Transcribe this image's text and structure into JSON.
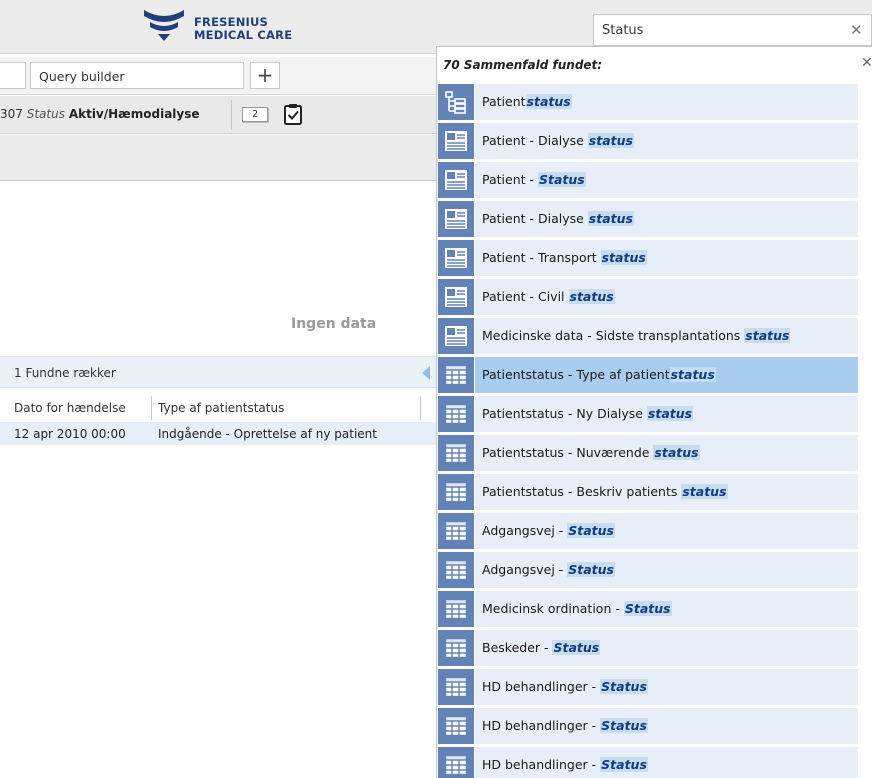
{
  "header": {
    "logo_line1": "FRESENIUS",
    "logo_line2": "MEDICAL CARE",
    "search_value": "Status",
    "search_clear": "✕"
  },
  "tabs": {
    "query_builder": "Query builder",
    "add": "+"
  },
  "status_bar": {
    "number": "307",
    "label": "Status",
    "value": "Aktiv/Hæmodialyse",
    "count": "2"
  },
  "main": {
    "no_data": "Ingen data",
    "found_rows": "1 Fundne rækker",
    "columns": [
      "Dato for hændelse",
      "Type af patientstatus"
    ],
    "rows": [
      [
        "12 apr 2010 00:00",
        "Indgående - Oprettelse af ny patient"
      ]
    ]
  },
  "results": {
    "header": "70 Sammenfald fundet:",
    "close": "✕",
    "highlight_color": "#0e3d80",
    "items": [
      {
        "prefix": "Patient",
        "match": "status",
        "icon": "tree-icon",
        "selected": false
      },
      {
        "prefix": "Patient - Dialyse ",
        "match": "status",
        "icon": "form-icon",
        "selected": false
      },
      {
        "prefix": "Patient - ",
        "match": "Status",
        "icon": "form-icon",
        "selected": false
      },
      {
        "prefix": "Patient - Dialyse ",
        "match": "status",
        "icon": "form-icon",
        "selected": false
      },
      {
        "prefix": "Patient - Transport ",
        "match": "status",
        "icon": "form-icon",
        "selected": false
      },
      {
        "prefix": "Patient - Civil ",
        "match": "status",
        "icon": "form-icon",
        "selected": false
      },
      {
        "prefix": "Medicinske data - Sidste transplantations ",
        "match": "status",
        "icon": "form-icon",
        "selected": false
      },
      {
        "prefix": "Patientstatus - Type af patient",
        "match": "status",
        "icon": "table-icon",
        "selected": true
      },
      {
        "prefix": "Patientstatus - Ny Dialyse ",
        "match": "status",
        "icon": "table-icon",
        "selected": false
      },
      {
        "prefix": "Patientstatus - Nuværende ",
        "match": "status",
        "icon": "table-icon",
        "selected": false
      },
      {
        "prefix": "Patientstatus - Beskriv patients ",
        "match": "status",
        "icon": "table-icon",
        "selected": false
      },
      {
        "prefix": "Adgangsvej - ",
        "match": "Status",
        "icon": "table-icon",
        "selected": false
      },
      {
        "prefix": "Adgangsvej - ",
        "match": "Status",
        "icon": "table-icon",
        "selected": false
      },
      {
        "prefix": "Medicinsk ordination - ",
        "match": "Status",
        "icon": "table-icon",
        "selected": false
      },
      {
        "prefix": "Beskeder - ",
        "match": "Status",
        "icon": "table-icon",
        "selected": false
      },
      {
        "prefix": "HD behandlinger - ",
        "match": "Status",
        "icon": "table-icon",
        "selected": false
      },
      {
        "prefix": "HD behandlinger - ",
        "match": "Status",
        "icon": "table-icon",
        "selected": false
      },
      {
        "prefix": "HD behandlinger - ",
        "match": "Status",
        "icon": "table-icon",
        "selected": false
      }
    ]
  }
}
